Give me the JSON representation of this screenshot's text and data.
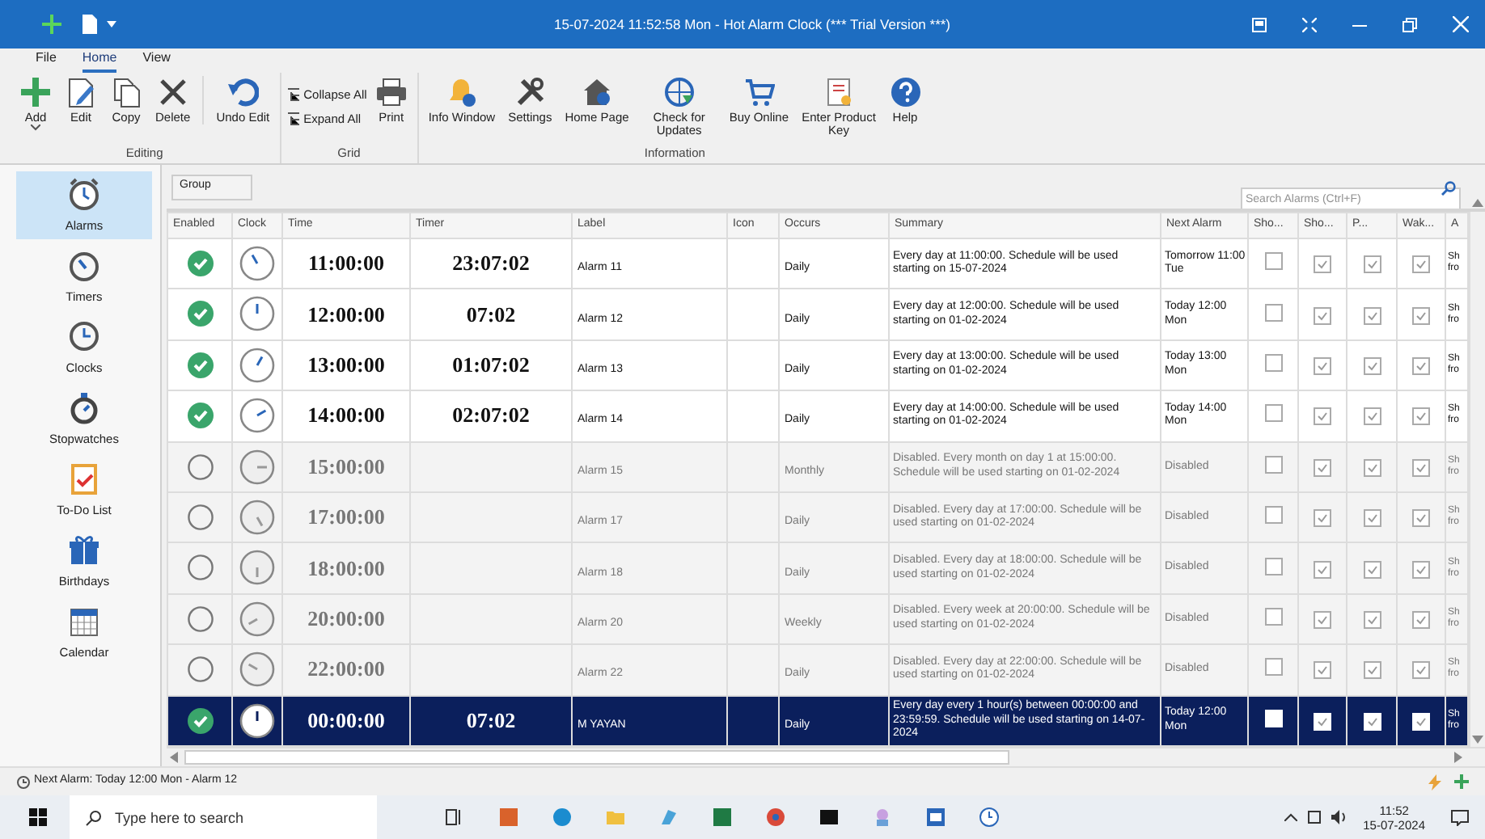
{
  "window": {
    "title": "15-07-2024 11:52:58 Mon - Hot Alarm Clock (*** Trial Version ***)"
  },
  "menu": [
    {
      "label": "File",
      "selected": false
    },
    {
      "label": "Home",
      "selected": true
    },
    {
      "label": "View",
      "selected": false
    }
  ],
  "ribbon": {
    "groups": [
      {
        "label": "Editing",
        "items": [
          {
            "kind": "add",
            "label": "Add"
          },
          {
            "kind": "edit",
            "label": "Edit"
          },
          {
            "kind": "copy",
            "label": "Copy"
          },
          {
            "kind": "delete",
            "label": "Delete"
          },
          {
            "kind": "undo",
            "label": "Undo Edit"
          }
        ]
      },
      {
        "label": "Grid",
        "items": [
          {
            "kind": "collapse",
            "label": "Collapse All"
          },
          {
            "kind": "expand",
            "label": "Expand All"
          },
          {
            "kind": "print",
            "label": "Print"
          }
        ]
      },
      {
        "label": "Information",
        "items": [
          {
            "kind": "info",
            "label": "Info Window"
          },
          {
            "kind": "settings",
            "label": "Settings"
          },
          {
            "kind": "home",
            "label": "Home Page"
          },
          {
            "kind": "update",
            "label": "Check for Updates"
          },
          {
            "kind": "buy",
            "label": "Buy Online"
          },
          {
            "kind": "key",
            "label": "Enter Product Key"
          },
          {
            "kind": "help",
            "label": "Help"
          }
        ]
      }
    ]
  },
  "sidebar": {
    "items": [
      {
        "kind": "alarm",
        "label": "Alarms",
        "selected": true
      },
      {
        "kind": "timer",
        "label": "Timers",
        "selected": false
      },
      {
        "kind": "clock",
        "label": "Clocks",
        "selected": false
      },
      {
        "kind": "stopwatch",
        "label": "Stopwatches",
        "selected": false
      },
      {
        "kind": "todo",
        "label": "To-Do List",
        "selected": false
      },
      {
        "kind": "gift",
        "label": "Birthdays",
        "selected": false
      },
      {
        "kind": "calendar",
        "label": "Calendar",
        "selected": false
      }
    ]
  },
  "group_button": "Group",
  "search": {
    "placeholder": "Search Alarms (Ctrl+F)"
  },
  "table": {
    "columns": [
      "Enabled",
      "Clock",
      "Time",
      "Timer",
      "Label",
      "Icon",
      "Occurs",
      "Summary",
      "Next Alarm",
      "Sho...",
      "Sho...",
      "P...",
      "Wak...",
      "A"
    ],
    "rows": [
      {
        "enabled": true,
        "selected": false,
        "time": "11:00:00",
        "timer": "23:07:02",
        "label": "Alarm 11",
        "occurs": "Daily",
        "summary": "Every day at 11:00:00. Schedule will be used starting on 15-07-2024",
        "next": "Tomorrow 11:00 Tue",
        "checks": [
          false,
          true,
          true,
          true
        ],
        "column_14": "Sh fro"
      },
      {
        "enabled": true,
        "selected": false,
        "time": "12:00:00",
        "timer": "07:02",
        "label": "Alarm 12",
        "occurs": "Daily",
        "summary": "Every day at 12:00:00. Schedule will be used starting on 01-02-2024",
        "next": "Today 12:00 Mon",
        "checks": [
          false,
          true,
          true,
          true
        ],
        "column_14": "Sh fro"
      },
      {
        "enabled": true,
        "selected": false,
        "time": "13:00:00",
        "timer": "01:07:02",
        "label": "Alarm 13",
        "occurs": "Daily",
        "summary": "Every day at 13:00:00. Schedule will be used starting on 01-02-2024",
        "next": "Today 13:00 Mon",
        "checks": [
          false,
          true,
          true,
          true
        ],
        "column_14": "Sh fro"
      },
      {
        "enabled": true,
        "selected": false,
        "time": "14:00:00",
        "timer": "02:07:02",
        "label": "Alarm 14",
        "occurs": "Daily",
        "summary": "Every day at 14:00:00. Schedule will be used starting on 01-02-2024",
        "next": "Today 14:00 Mon",
        "checks": [
          false,
          true,
          true,
          true
        ],
        "column_14": "Sh fro"
      },
      {
        "enabled": false,
        "selected": false,
        "time": "15:00:00",
        "label": "Alarm 15",
        "occurs": "Monthly",
        "summary": "Disabled. Every month on day 1 at 15:00:00. Schedule will be used starting on 01-02-2024",
        "next": "Disabled",
        "checks": [
          false,
          true,
          true,
          true
        ],
        "column_14": "Sh fro"
      },
      {
        "enabled": false,
        "selected": false,
        "time": "17:00:00",
        "label": "Alarm 17",
        "occurs": "Daily",
        "summary": "Disabled. Every day at 17:00:00. Schedule will be used starting on 01-02-2024",
        "next": "Disabled",
        "checks": [
          false,
          true,
          true,
          true
        ],
        "column_14": "Sh fro"
      },
      {
        "enabled": false,
        "selected": false,
        "time": "18:00:00",
        "label": "Alarm 18",
        "occurs": "Daily",
        "summary": "Disabled. Every day at 18:00:00. Schedule will be used starting on 01-02-2024",
        "next": "Disabled",
        "checks": [
          false,
          true,
          true,
          true
        ],
        "column_14": "Sh fro"
      },
      {
        "enabled": false,
        "selected": false,
        "time": "20:00:00",
        "label": "Alarm 20",
        "occurs": "Weekly",
        "summary": "Disabled. Every week at 20:00:00. Schedule will be used starting on 01-02-2024",
        "next": "Disabled",
        "checks": [
          false,
          true,
          true,
          true
        ],
        "column_14": "Sh fro"
      },
      {
        "enabled": false,
        "selected": false,
        "time": "22:00:00",
        "label": "Alarm 22",
        "occurs": "Daily",
        "summary": "Disabled. Every day at 22:00:00. Schedule will be used starting on 01-02-2024",
        "next": "Disabled",
        "checks": [
          false,
          true,
          true,
          true
        ],
        "column_14": "Sh fro"
      },
      {
        "enabled": true,
        "selected": true,
        "time": "00:00:00",
        "timer": "07:02",
        "label": "M YAYAN",
        "occurs": "Daily",
        "summary": "Every day every 1 hour(s) between 00:00:00 and 23:59:59. Schedule will be used starting on 14-07-2024",
        "next": "Today 12:00 Mon",
        "checks": [
          false,
          true,
          true,
          true
        ],
        "column_14": "Sh fro"
      }
    ]
  },
  "status_bar": "Next Alarm: Today 12:00 Mon - Alarm 12",
  "taskbar": {
    "search_placeholder": "Type here to search",
    "time": "11:52",
    "date": "15-07-2024"
  }
}
